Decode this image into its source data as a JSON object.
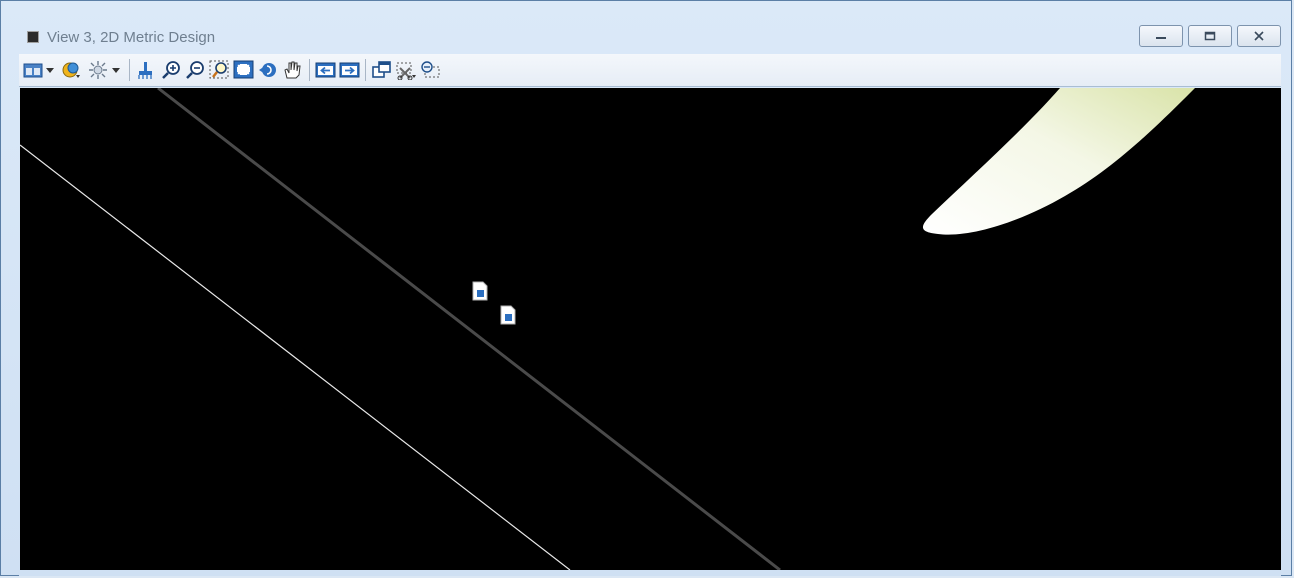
{
  "window": {
    "title": "View 3, 2D Metric Design",
    "controls": {
      "minimize": "minimize",
      "restore": "restore",
      "close": "close"
    }
  },
  "toolbar": {
    "items": [
      {
        "name": "view-attributes-icon",
        "has_dropdown": true
      },
      {
        "name": "display-style-icon",
        "has_dropdown": false
      },
      {
        "name": "lighting-icon",
        "has_dropdown": true
      },
      {
        "name": "update-view-icon"
      },
      {
        "name": "zoom-in-icon"
      },
      {
        "name": "zoom-out-icon"
      },
      {
        "name": "window-area-icon"
      },
      {
        "name": "fit-view-icon"
      },
      {
        "name": "rotate-view-icon"
      },
      {
        "name": "pan-view-icon"
      },
      {
        "name": "view-previous-icon"
      },
      {
        "name": "view-next-icon"
      },
      {
        "name": "copy-view-icon"
      },
      {
        "name": "clip-volume-icon"
      },
      {
        "name": "clip-mask-icon"
      }
    ]
  },
  "canvas": {
    "background": "#000000",
    "line_colors": {
      "thick_line": "#4a4a4a",
      "thin_line": "#e8e8e8"
    },
    "shape_colors": {
      "leaf_light": "#ffffff",
      "leaf_tint": "#dce6b0"
    },
    "markers": [
      {
        "name": "raster-reference-marker"
      },
      {
        "name": "raster-reference-marker"
      }
    ]
  }
}
